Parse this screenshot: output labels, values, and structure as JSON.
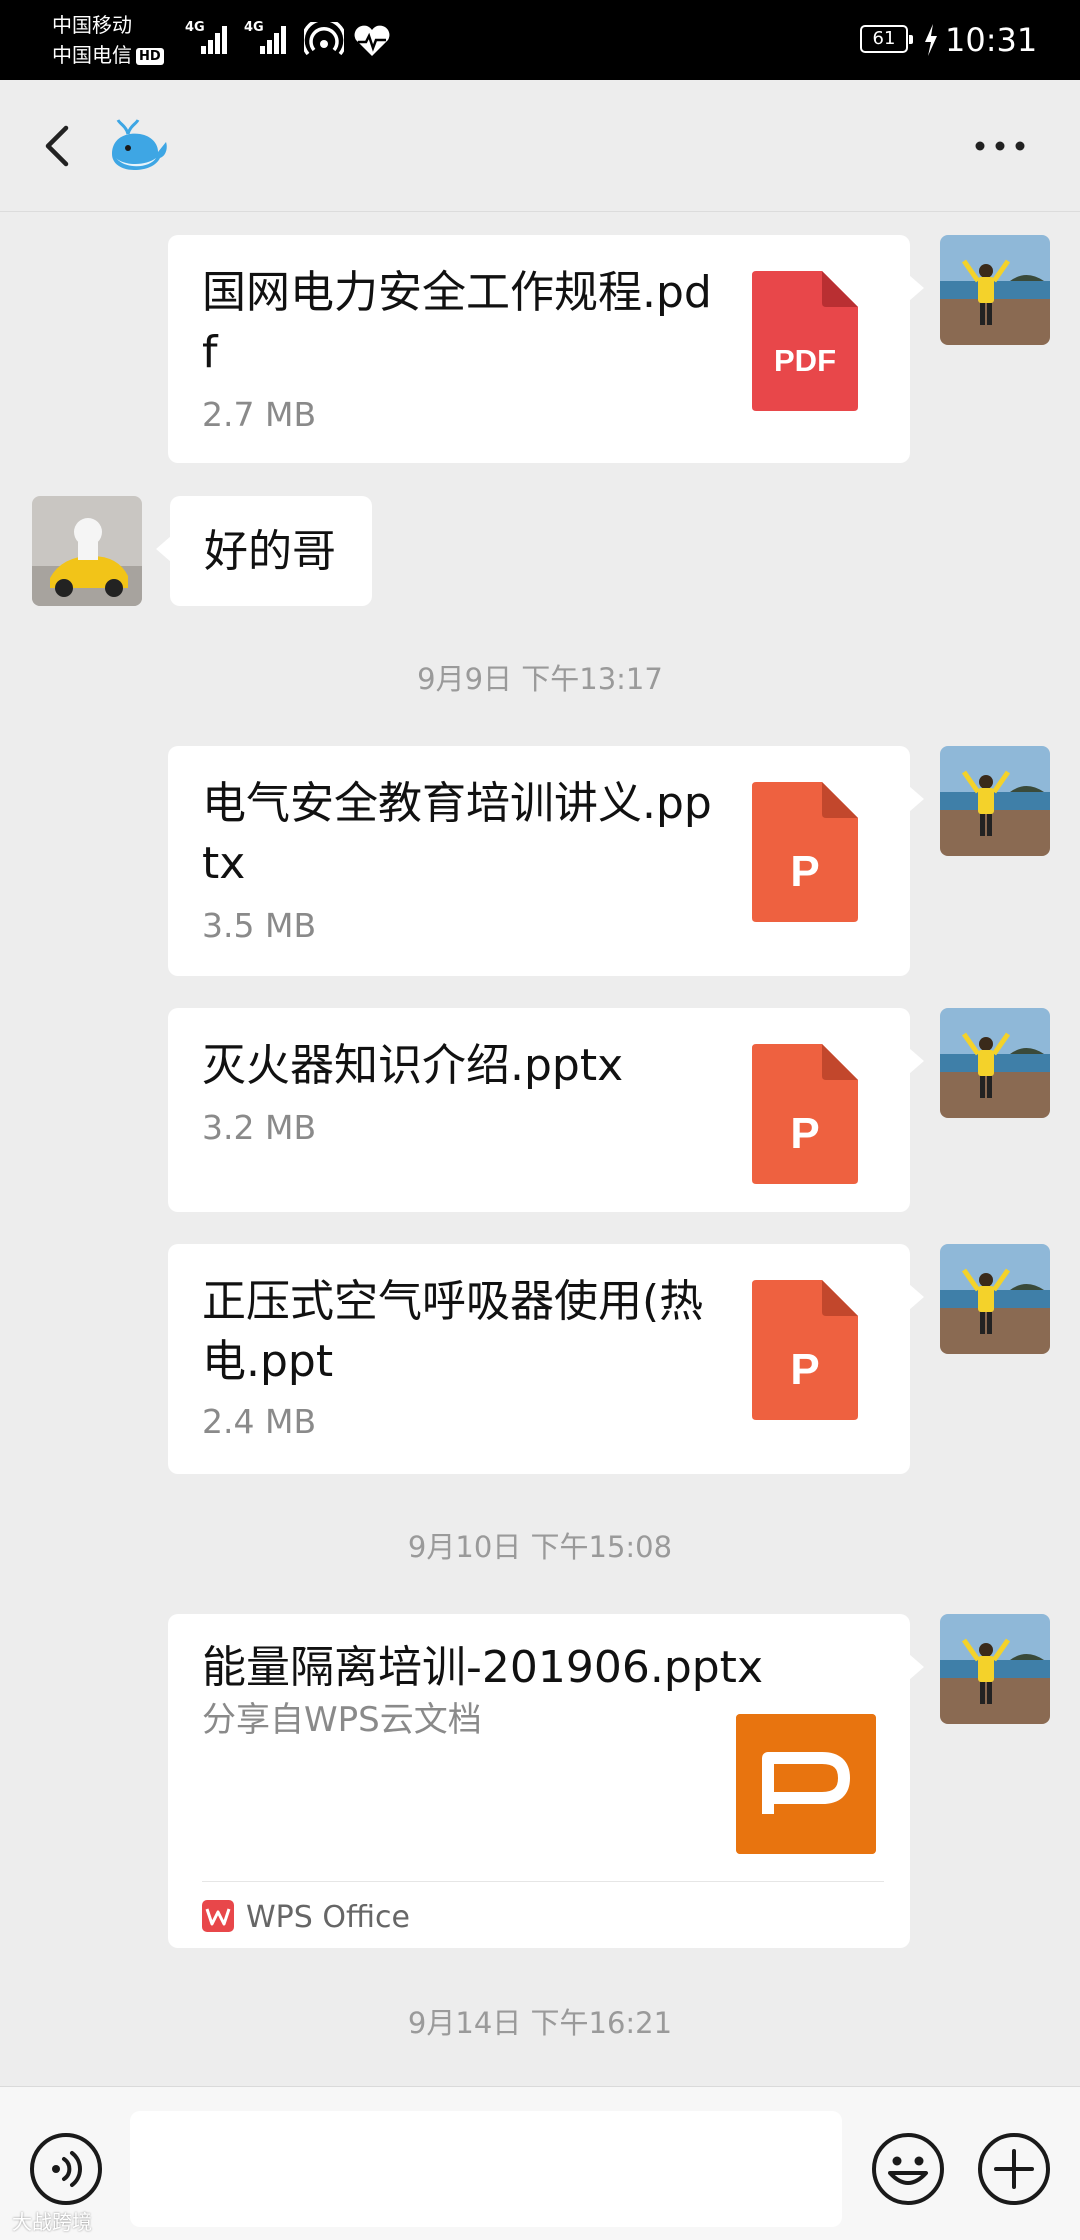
{
  "status_bar": {
    "carrier_1": "中国移动",
    "carrier_2": "中国电信",
    "hd_badge": "HD",
    "network_1": "4G",
    "network_2": "4G",
    "battery_level": "61",
    "time": "10:31"
  },
  "header": {
    "back_icon": "chevron-left-icon",
    "contact_avatar": "whale-emoji",
    "more_icon": "more-dots-icon"
  },
  "messages": [
    {
      "side": "right",
      "type": "file",
      "name": "国网电力安全工作规程.pdf",
      "size": "2.7 MB",
      "icon_label": "PDF",
      "icon_color": "#e8474a"
    },
    {
      "side": "left",
      "type": "text",
      "text": "好的哥"
    },
    {
      "type": "timestamp",
      "text": "9月9日 下午13:17"
    },
    {
      "side": "right",
      "type": "file",
      "name": "电气安全教育培训讲义.pptx",
      "size": "3.5 MB",
      "icon_label": "P",
      "icon_color": "#ee6140"
    },
    {
      "side": "right",
      "type": "file",
      "name": "灭火器知识介绍.pptx",
      "size": "3.2 MB",
      "icon_label": "P",
      "icon_color": "#ee6140"
    },
    {
      "side": "right",
      "type": "file",
      "name": "正压式空气呼吸器使用(热电.ppt",
      "size": "2.4 MB",
      "icon_label": "P",
      "icon_color": "#ee6140"
    },
    {
      "type": "timestamp",
      "text": "9月10日 下午15:08"
    },
    {
      "side": "right",
      "type": "link",
      "title": "能量隔离培训-201906.pptx",
      "subtitle": "分享自WPS云文档",
      "source": "WPS Office",
      "thumb_color": "#e8740f"
    },
    {
      "type": "timestamp",
      "text": "9月14日 下午16:21"
    }
  ],
  "input_bar": {
    "voice_icon": "voice-icon",
    "input_value": "",
    "emoji_icon": "emoji-icon",
    "plus_icon": "plus-icon"
  },
  "colors": {
    "background": "#ededed",
    "bubble": "#ffffff",
    "pdf_red": "#e8474a",
    "ppt_orange": "#ee6140",
    "wps_orange": "#e8740f"
  },
  "watermark": "大战跨境"
}
